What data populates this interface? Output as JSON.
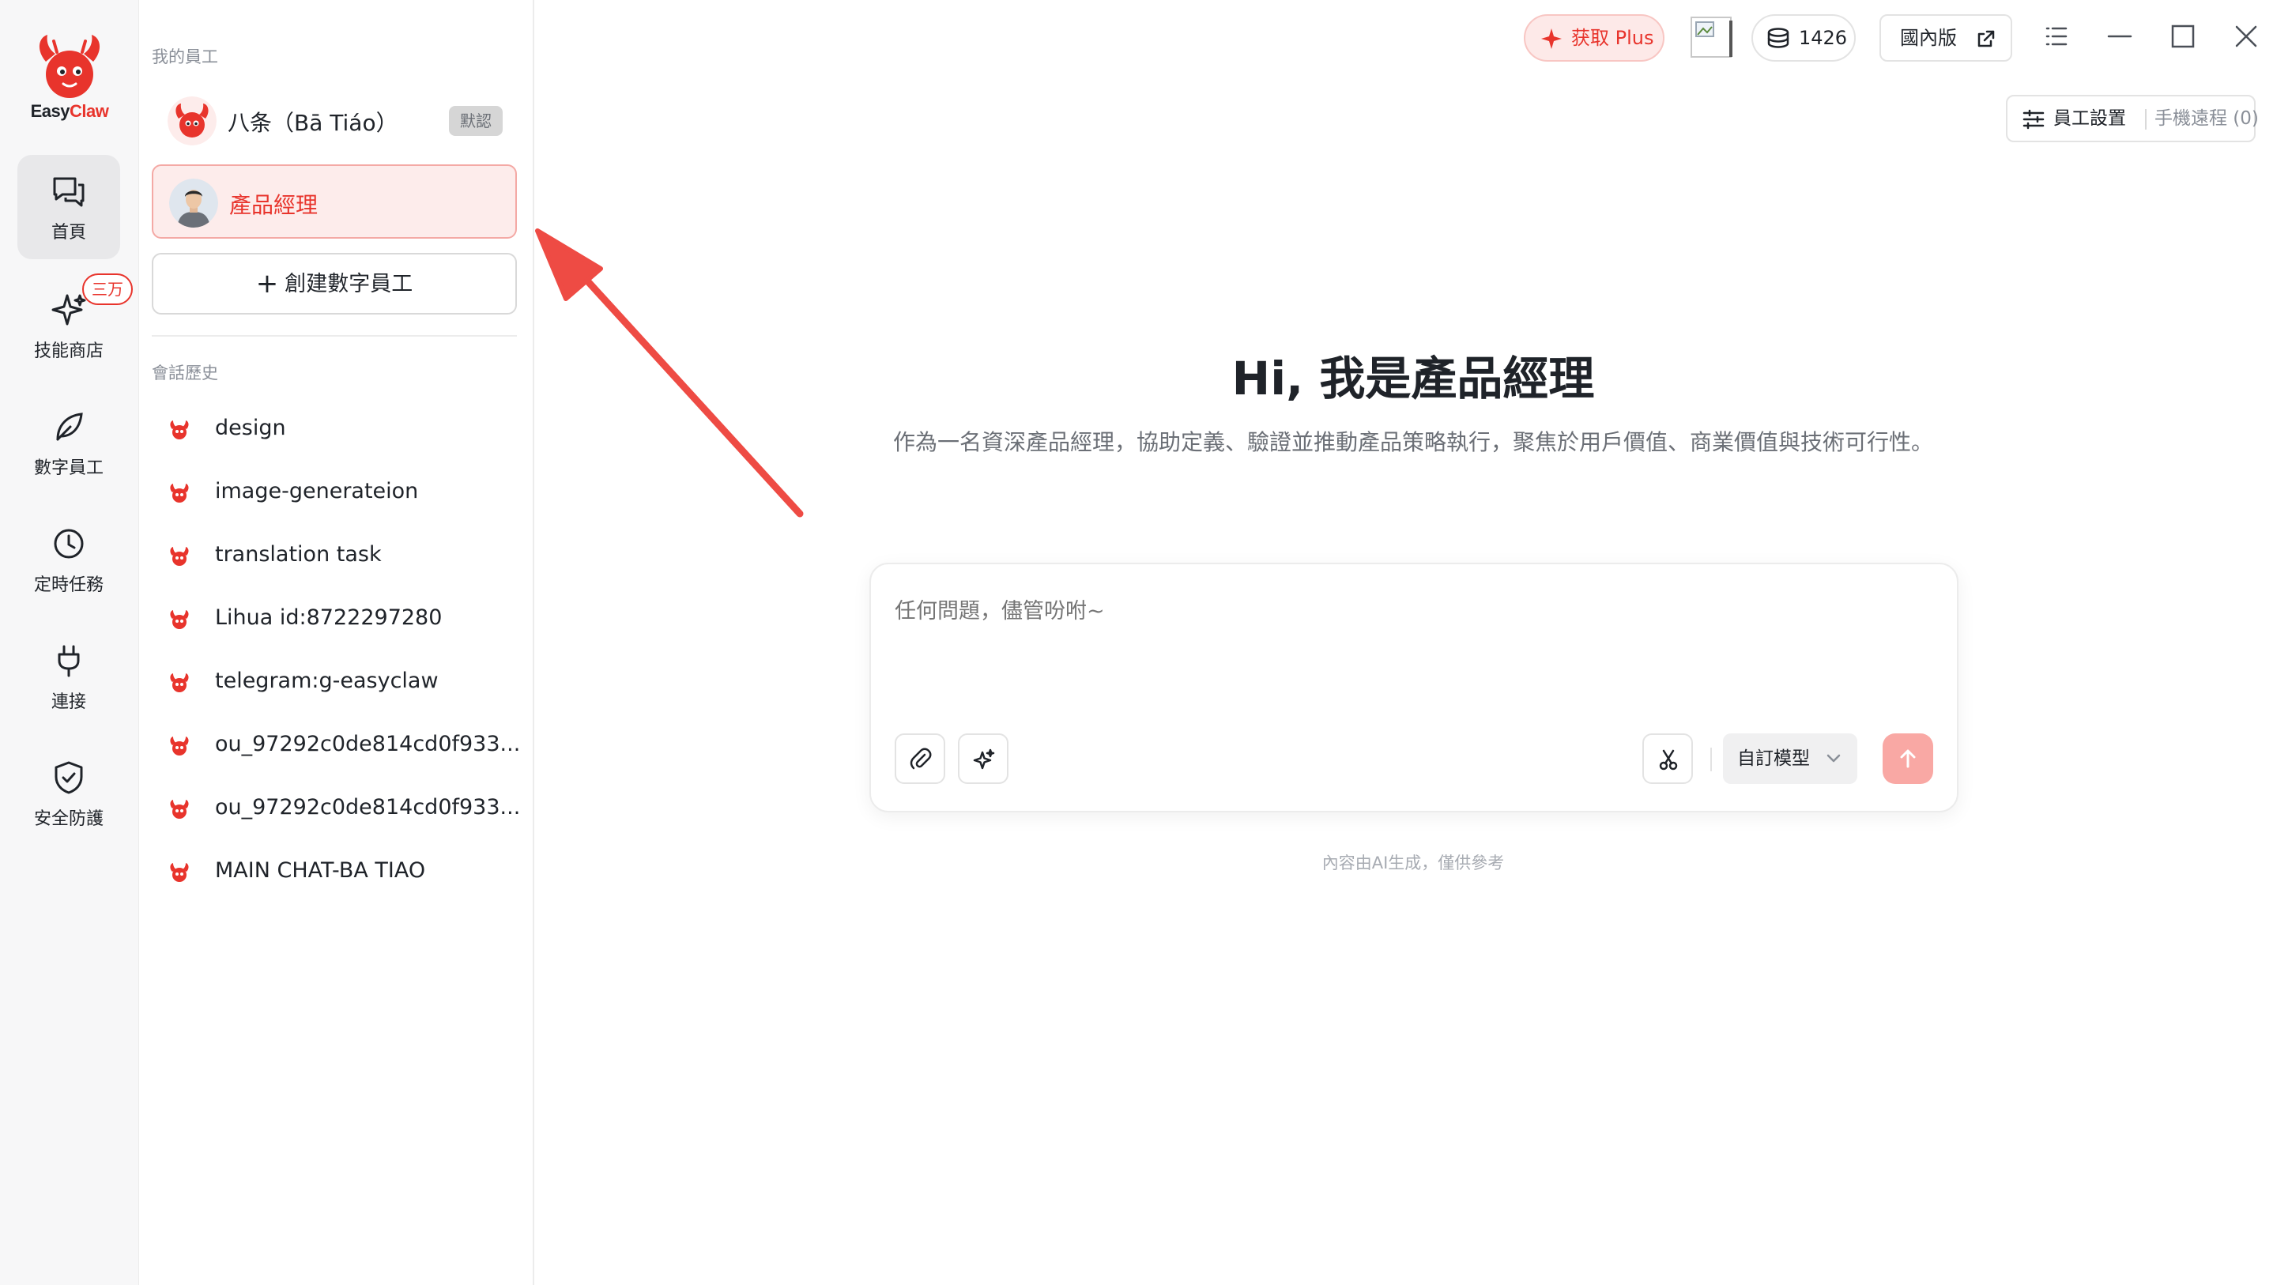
{
  "app": {
    "brand_easy": "Easy",
    "brand_claw": "Claw"
  },
  "rail": {
    "items": [
      {
        "label": "首頁",
        "icon": "chat-bubbles-icon"
      },
      {
        "label": "技能商店",
        "icon": "sparkle-icon",
        "badge": "三万"
      },
      {
        "label": "數字員工",
        "icon": "leaf-icon"
      },
      {
        "label": "定時任務",
        "icon": "clock-icon"
      },
      {
        "label": "連接",
        "icon": "plug-icon"
      },
      {
        "label": "安全防護",
        "icon": "shield-check-icon"
      }
    ]
  },
  "sidebar": {
    "employees_title": "我的員工",
    "employees": [
      {
        "name": "八条（Bā Tiáo）",
        "tag": "默認"
      },
      {
        "name": "產品經理"
      }
    ],
    "create_label": "創建數字員工",
    "history_title": "會話歷史",
    "history": [
      "design",
      "image-generateion",
      "translation task",
      "Lihua id:8722297280",
      "telegram:g-easyclaw",
      "ou_97292c0de814cd0f933...",
      "ou_97292c0de814cd0f933...",
      "MAIN CHAT-BA TIAO"
    ]
  },
  "topbar": {
    "plus_label": "获取 Plus",
    "coins": "1426",
    "region_label": "國內版",
    "settings_label": "員工設置",
    "remote_label": "手機遠程 (0)"
  },
  "hero": {
    "title": "Hi, 我是產品經理",
    "description": "作為一名資深產品經理，協助定義、驗證並推動產品策略執行，聚焦於用戶價值、商業價值與技術可行性。"
  },
  "composer": {
    "placeholder": "任何問題，儘管吩咐~",
    "model_label": "自訂模型"
  },
  "footer": {
    "note": "內容由AI生成，僅供參考"
  },
  "colors": {
    "accent": "#e8342c",
    "accent_soft": "#fdeceb",
    "send_disabled": "#f9a8a4"
  }
}
